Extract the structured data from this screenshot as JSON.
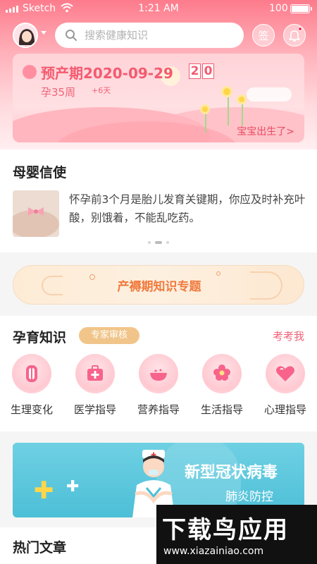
{
  "status_bar": {
    "carrier": "Sketch",
    "time": "1:21 AM",
    "battery": "100"
  },
  "header": {
    "search_placeholder": "搜索健康知识",
    "sign_label": "签",
    "icons": {
      "avatar": "user-avatar",
      "search": "search-icon",
      "bell": "bell-icon"
    }
  },
  "pregnancy": {
    "due_label": "预产期2020-09-29",
    "countdown": [
      "2",
      "0"
    ],
    "week": "孕35周",
    "week_extra": "+6天",
    "baby_born_link": "宝宝出生了>"
  },
  "news": {
    "title": "母婴信使",
    "text": "怀孕前3个月是胎儿发育关键期，你应及时补充叶酸，别饿着，不能乱吃药。",
    "page_index": 1,
    "page_count": 3
  },
  "topic_banner": {
    "label": "产褥期知识专题"
  },
  "knowledge": {
    "title": "孕育知识",
    "badge": "专家审核",
    "quiz_link": "考考我",
    "categories": [
      {
        "label": "生理变化",
        "icon": "uterus-icon"
      },
      {
        "label": "医学指导",
        "icon": "medical-kit-icon"
      },
      {
        "label": "营养指导",
        "icon": "food-bowl-icon"
      },
      {
        "label": "生活指导",
        "icon": "flower-icon"
      },
      {
        "label": "心理指导",
        "icon": "heart-icon"
      }
    ]
  },
  "covid_banner": {
    "title": "新型冠状病毒",
    "subtitle": "肺炎防控"
  },
  "hot_articles": {
    "title": "热门文章"
  },
  "watermark": {
    "brand": "下载鸟应用",
    "url": "www.xiazainiao.com"
  }
}
